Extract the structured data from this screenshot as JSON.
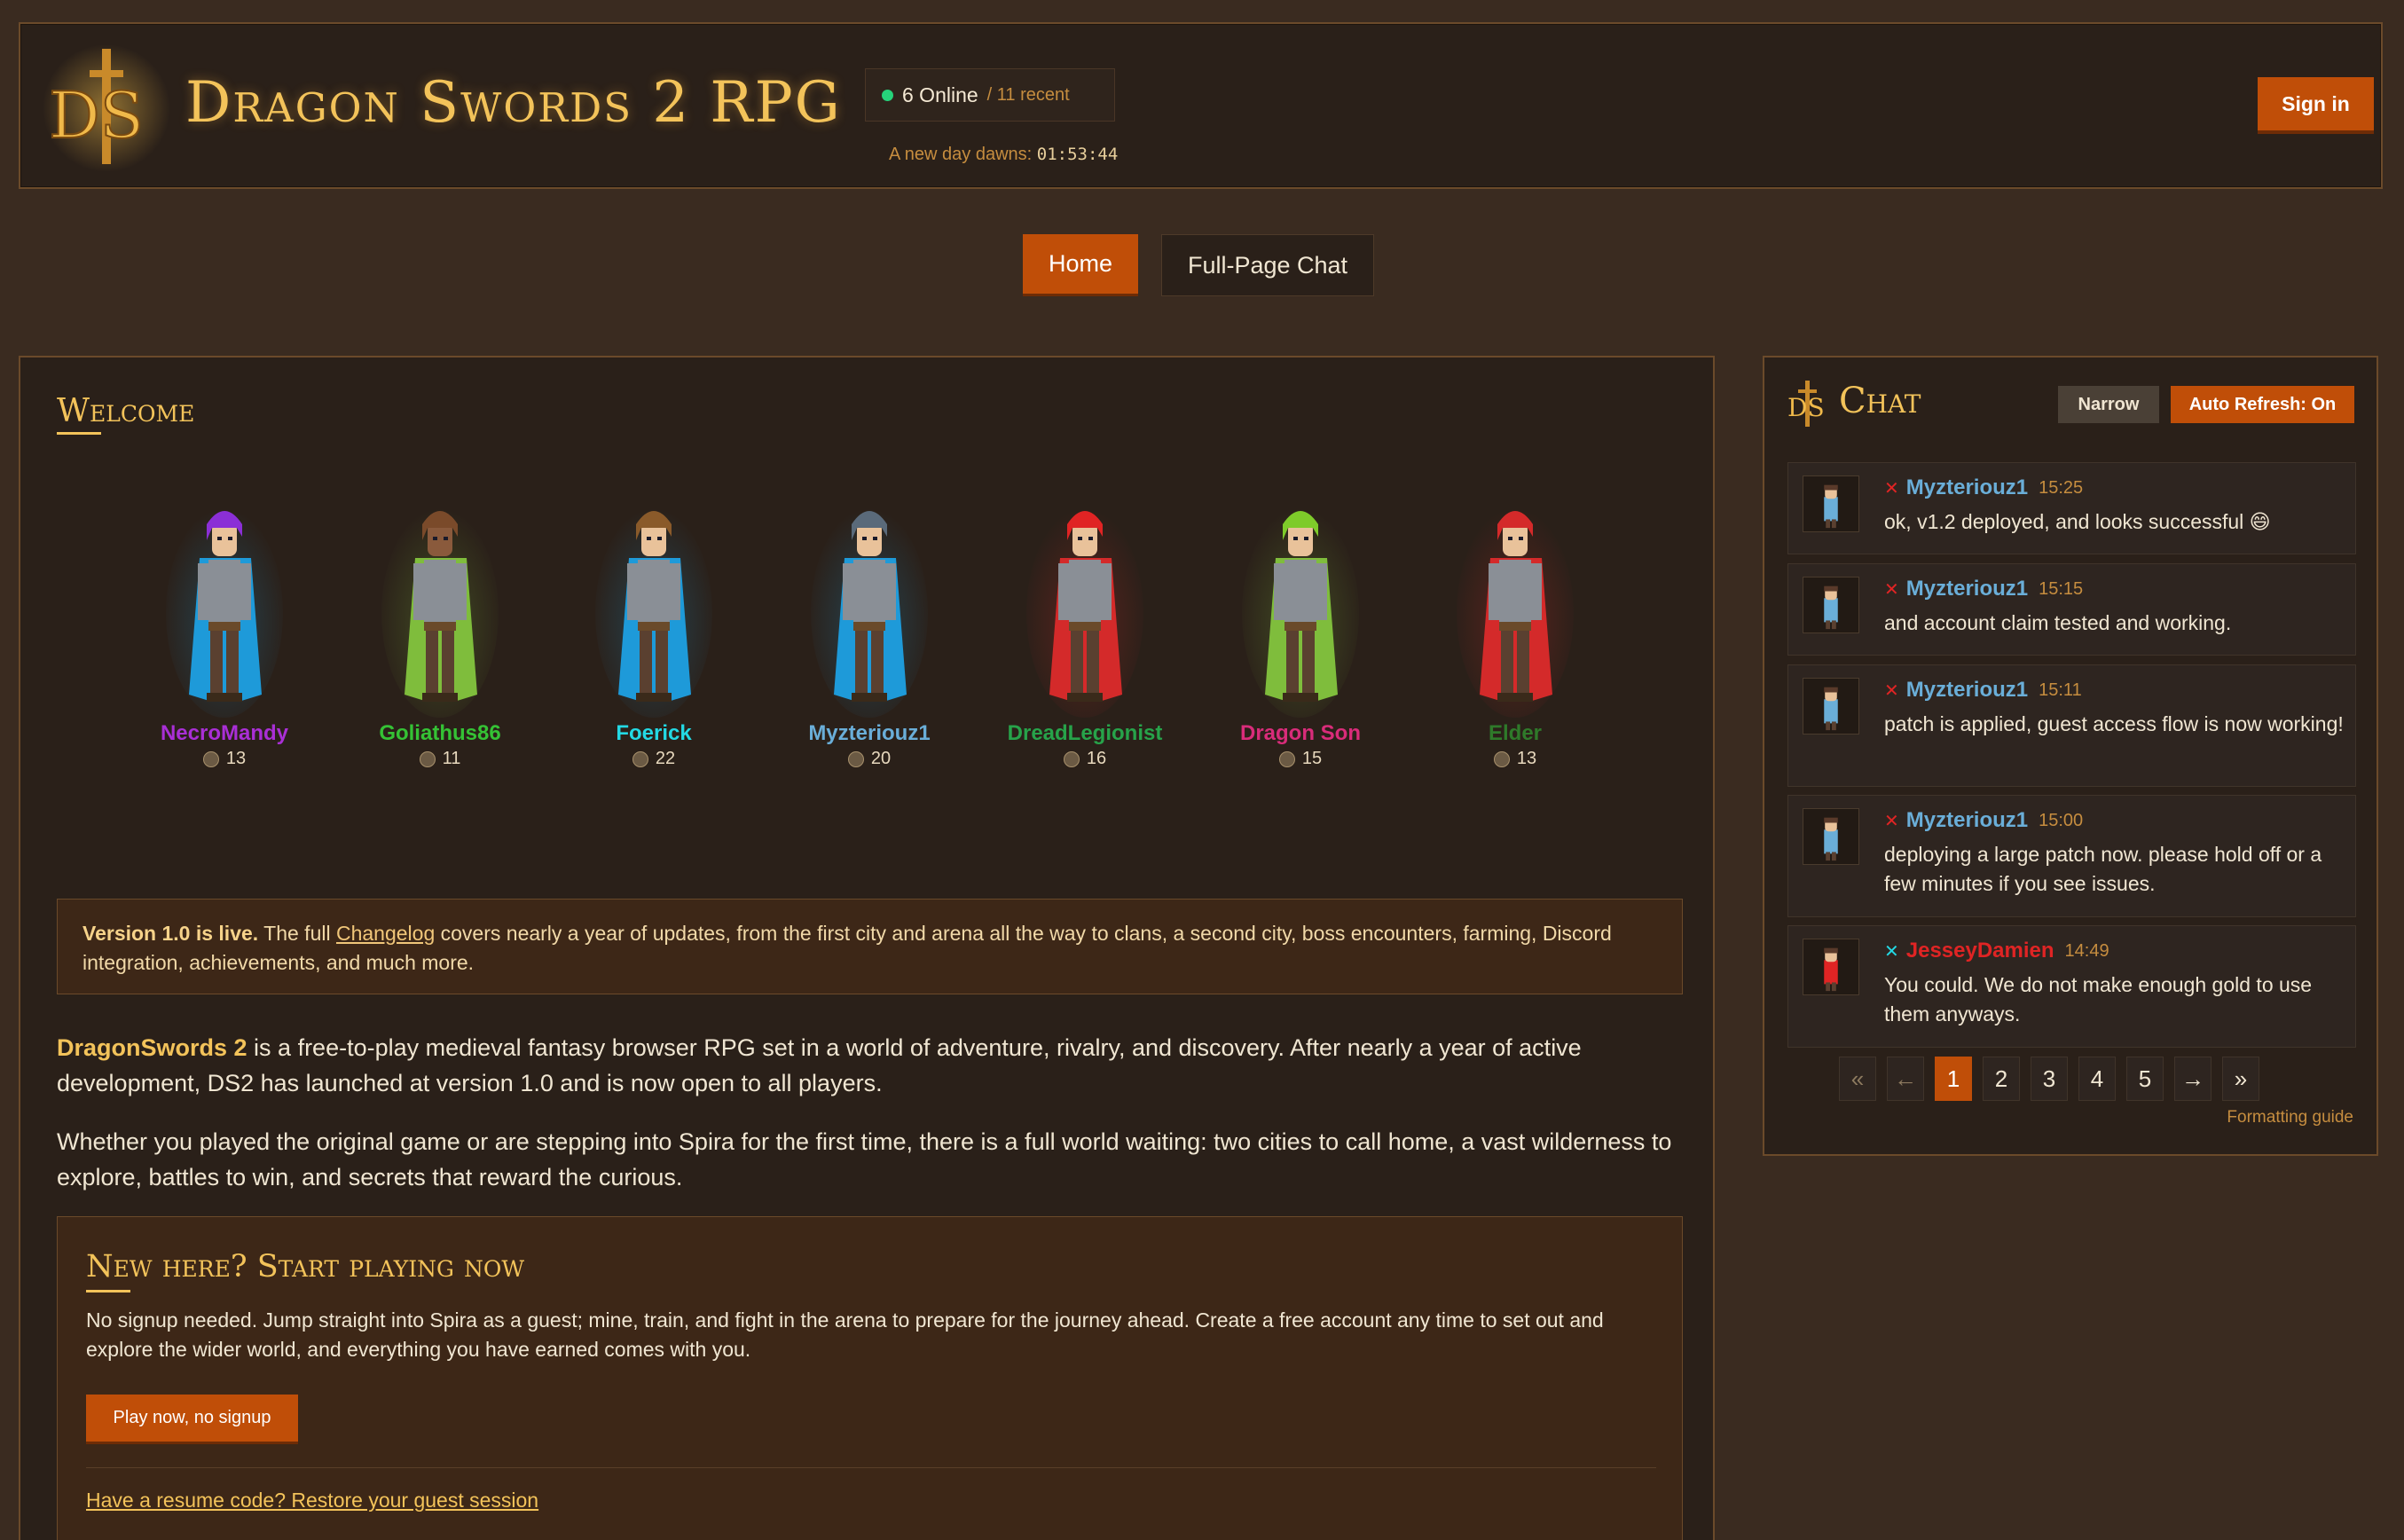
{
  "header": {
    "title": "Dragon Swords 2 RPG",
    "online_count": "6 Online",
    "online_recent": "/ 11 recent",
    "dawn_label": "A new day dawns:",
    "dawn_time": "01:53:44",
    "signin_label": "Sign in"
  },
  "nav": {
    "home": "Home",
    "chat": "Full-Page Chat"
  },
  "welcome": {
    "title": "Welcome",
    "players": [
      {
        "name": "NecroMandy",
        "level": "13",
        "color": "#a92fd6",
        "hair": "#8b2fd6",
        "cape": "#1e9ad9",
        "skin": "#e9c29a"
      },
      {
        "name": "Goliathus86",
        "level": "11",
        "color": "#35c235",
        "hair": "#7a4a2a",
        "cape": "#7fbd3c",
        "skin": "#8a5a3c"
      },
      {
        "name": "Foerick",
        "level": "22",
        "color": "#23d9e4",
        "hair": "#8a5a2a",
        "cape": "#1e9ad9",
        "skin": "#e9c29a"
      },
      {
        "name": "Myzteriouz1",
        "level": "20",
        "color": "#6aaed8",
        "hair": "#5a6a7a",
        "cape": "#1e9ad9",
        "skin": "#e9c29a"
      },
      {
        "name": "DreadLegionist",
        "level": "16",
        "color": "#27a34a",
        "hair": "#e02424",
        "cape": "#d42a2a",
        "skin": "#e9c29a"
      },
      {
        "name": "Dragon Son",
        "level": "15",
        "color": "#d92c7a",
        "hair": "#7ecb2a",
        "cape": "#7fbd3c",
        "skin": "#e9c29a"
      },
      {
        "name": "Elder",
        "level": "13",
        "color": "#2f7a2a",
        "hair": "#d42a2a",
        "cape": "#d42a2a",
        "skin": "#e9c29a"
      }
    ],
    "notice_bold": "Version 1.0 is live.",
    "notice_pre": " The full ",
    "notice_link": "Changelog",
    "notice_post": " covers nearly a year of updates, from the first city and arena all the way to clans, a second city, boss encounters, farming, Discord integration, achievements, and much more.",
    "intro_bold": "DragonSwords 2",
    "intro_text": " is a free-to-play medieval fantasy browser RPG set in a world of adventure, rivalry, and discovery. After nearly a year of active development, DS2 has launched at version 1.0 and is now open to all players.",
    "intro2": "Whether you played the original game or are stepping into Spira for the first time, there is a full world waiting: two cities to call home, a vast wilderness to explore, battles to win, and secrets that reward the curious.",
    "start_title": "New here? Start playing now",
    "start_text": "No signup needed. Jump straight into Spira as a guest; mine, train, and fight in the arena to prepare for the journey ahead. Create a free account any time to set out and explore the wider world, and everything you have earned comes with you.",
    "play_button": "Play now, no signup",
    "resume_link": "Have a resume code? Restore your guest session"
  },
  "chat": {
    "title": "Chat",
    "narrow_label": "Narrow",
    "refresh_label": "Auto Refresh: On",
    "messages": [
      {
        "user": "Myzteriouz1",
        "time": "15:25",
        "text": "ok, v1.2 deployed, and looks successful 😄",
        "user_color": "#6aaed8",
        "x_color": "#e02424"
      },
      {
        "user": "Myzteriouz1",
        "time": "15:15",
        "text": "and account claim tested and working.",
        "user_color": "#6aaed8",
        "x_color": "#e02424"
      },
      {
        "user": "Myzteriouz1",
        "time": "15:11",
        "text": "patch is applied, guest access flow is now working!",
        "user_color": "#6aaed8",
        "x_color": "#e02424"
      },
      {
        "user": "Myzteriouz1",
        "time": "15:00",
        "text": "deploying a large patch now. please hold off or a few minutes if you see issues.",
        "user_color": "#6aaed8",
        "x_color": "#e02424"
      },
      {
        "user": "JesseyDamien",
        "time": "14:49",
        "text": "You could. We do not make enough gold to use them anyways.",
        "user_color": "#e02424",
        "x_color": "#23d9e4"
      }
    ],
    "pager": [
      "«",
      "←",
      "1",
      "2",
      "3",
      "4",
      "5",
      "→",
      "»"
    ],
    "formatting_guide": "Formatting guide"
  }
}
